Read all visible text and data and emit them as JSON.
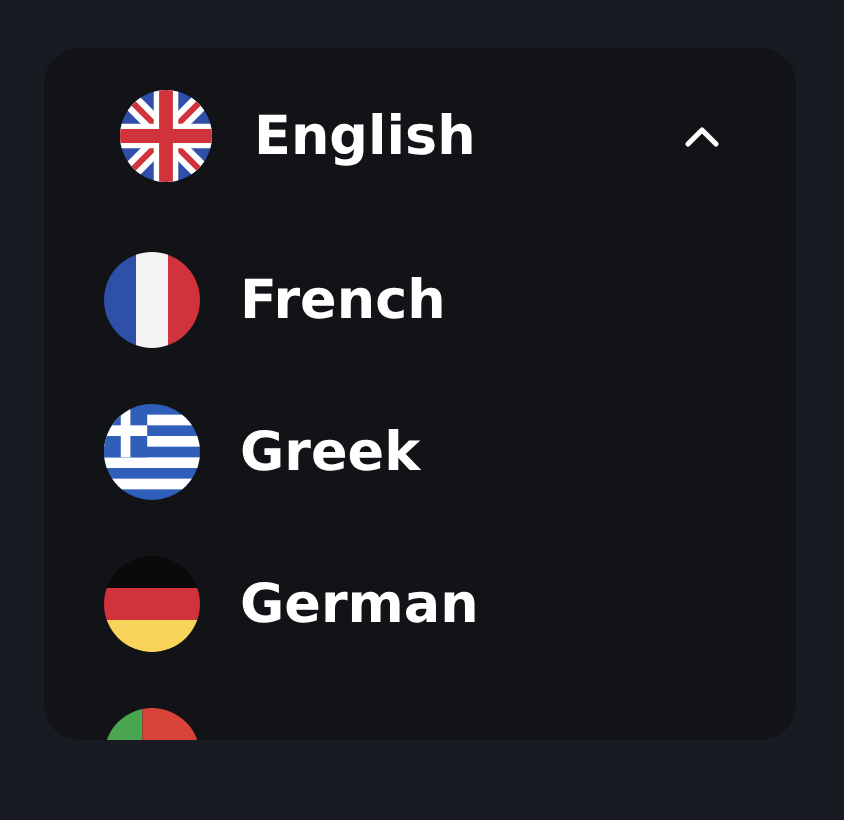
{
  "dropdown": {
    "expanded": true,
    "current": {
      "label": "English",
      "kind": "uk"
    },
    "options": [
      {
        "label": "French",
        "kind": "france"
      },
      {
        "label": "Greek",
        "kind": "greece"
      },
      {
        "label": "German",
        "kind": "germany"
      },
      {
        "kind": "portugal"
      }
    ]
  }
}
